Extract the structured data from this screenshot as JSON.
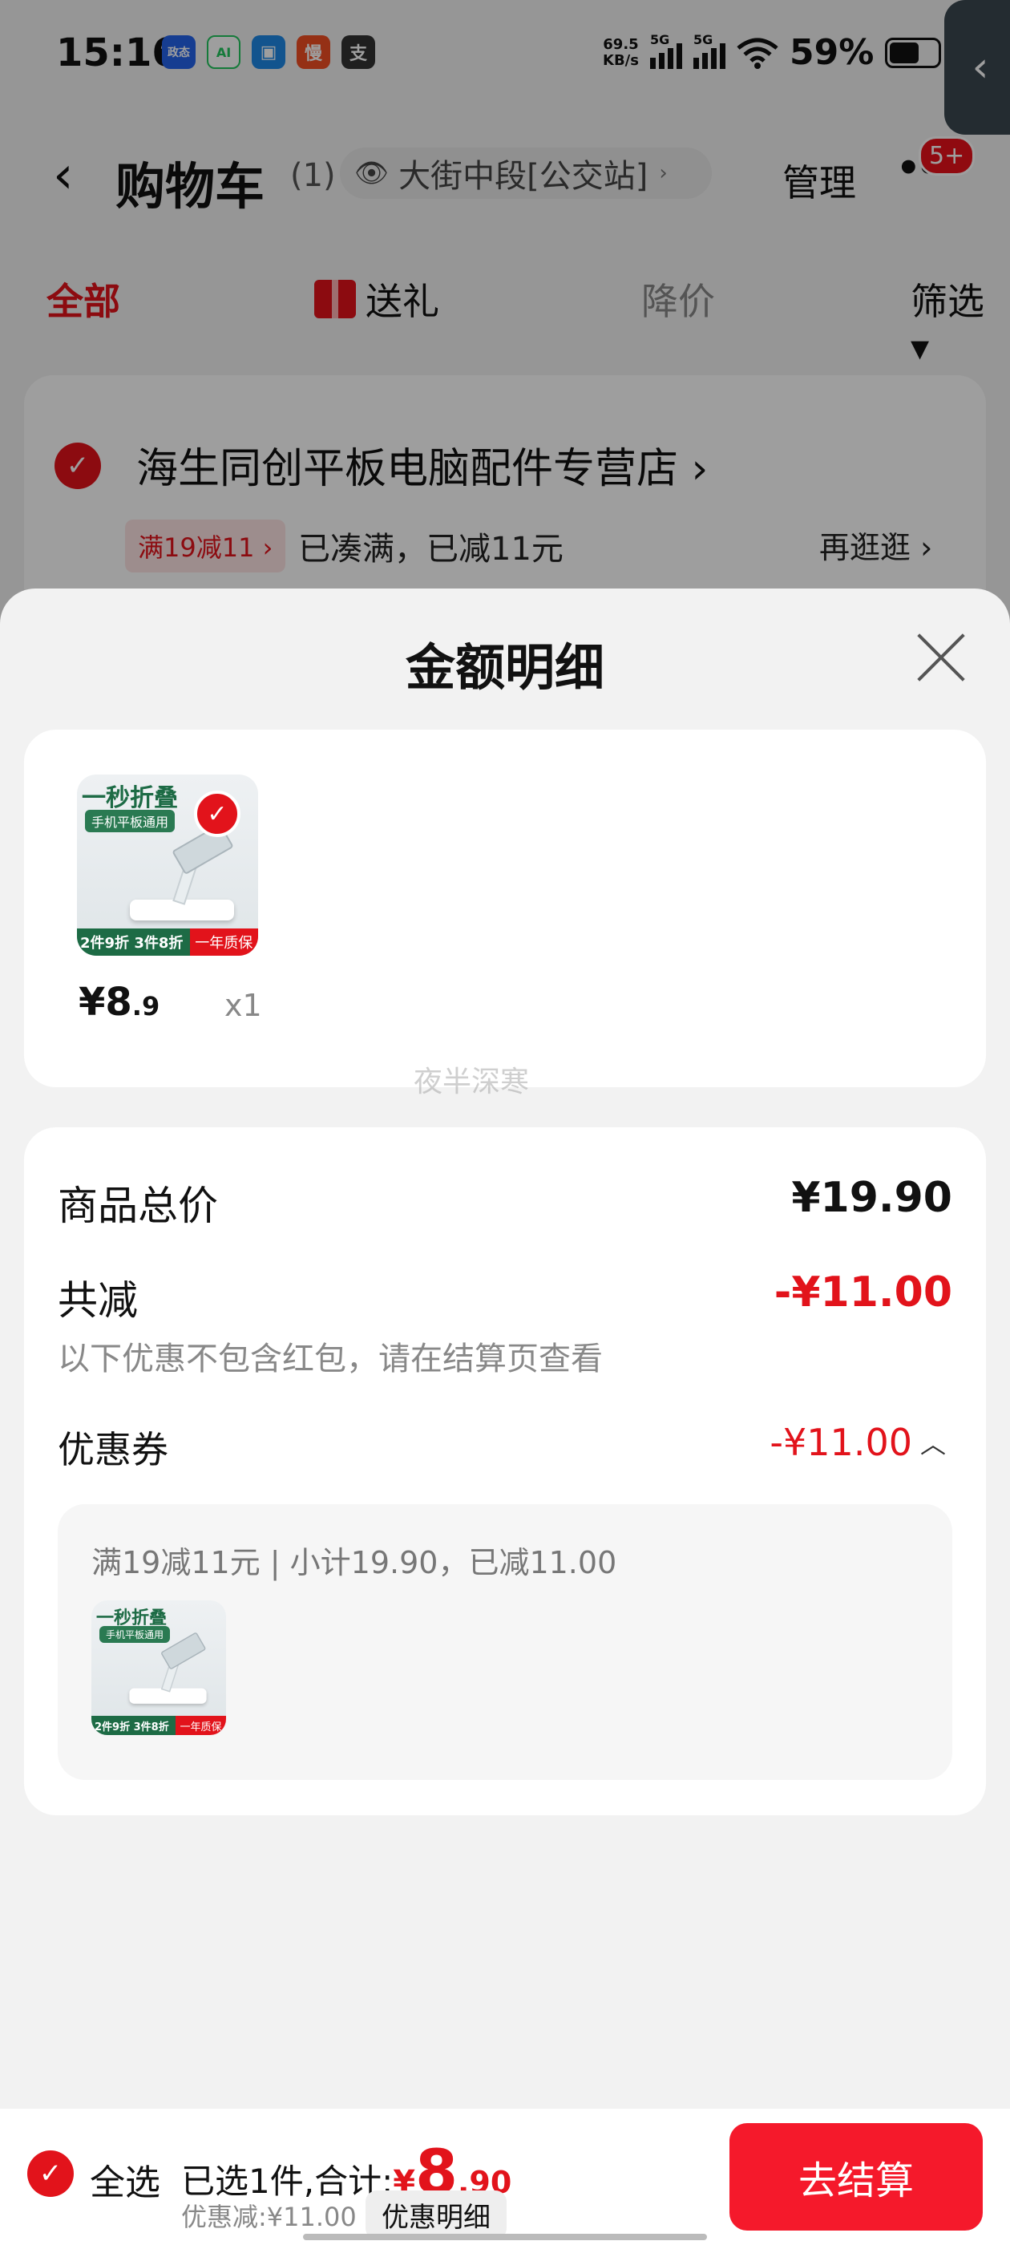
{
  "status_bar": {
    "time": "15:16",
    "app_icons": [
      {
        "name": "政态",
        "color": "#2563eb"
      },
      {
        "name": "AI",
        "color": "#22c55e"
      },
      {
        "name": "▣",
        "color": "#1e88e5"
      },
      {
        "name": "慢",
        "color": "#f04e23"
      },
      {
        "name": "支",
        "color": "#333333"
      }
    ],
    "net_speed_value": "69.5",
    "net_speed_unit": "KB/s",
    "signal_1": "5G",
    "signal_2": "5G",
    "battery": "59%"
  },
  "nav": {
    "title": "购物车",
    "count": "(1)",
    "location": "大街中段[公交站]",
    "manage": "管理",
    "more": "•••",
    "badge": "5+"
  },
  "tabs": [
    {
      "label": "全部"
    },
    {
      "label": "送礼"
    },
    {
      "label": "降价"
    },
    {
      "label": "筛选 ▾"
    }
  ],
  "store": {
    "name": "海生同创平板电脑配件专营店 ›",
    "coupon_tag": "满19减11 ›",
    "coupon_msg": "已凑满，已减11元",
    "browse": "再逛逛 ›"
  },
  "sheet": {
    "title": "金额明细",
    "product": {
      "thumb_title": "一秒折叠",
      "thumb_sub": "手机平板通用",
      "thumb_foot_left": "2件9折 3件8折",
      "thumb_foot_right": "一年质保",
      "price_int": "¥8",
      "price_dec": ".9",
      "qty": "x1"
    },
    "details": {
      "total_label": "商品总价",
      "total_value": "¥19.90",
      "reduce_label": "共减",
      "reduce_value": "-¥11.00",
      "note": "以下优惠不包含红包，请在结算页查看",
      "coupon_label": "优惠券",
      "coupon_value": "-¥11.00",
      "coupon_desc": "满19减11元 | 小计19.90，已减11.00"
    },
    "watermark": "夜半深寒"
  },
  "bottom_bar": {
    "select_all": "全选",
    "total_prefix": "已选1件,合计:",
    "currency": "¥",
    "total_int": "8",
    "total_dec": ".90",
    "discount": "优惠减:¥11.00",
    "detail_button": "优惠明细",
    "checkout": "去结算"
  },
  "colors": {
    "accent_red": "#e2131b",
    "checkout_red": "#f5192b"
  }
}
